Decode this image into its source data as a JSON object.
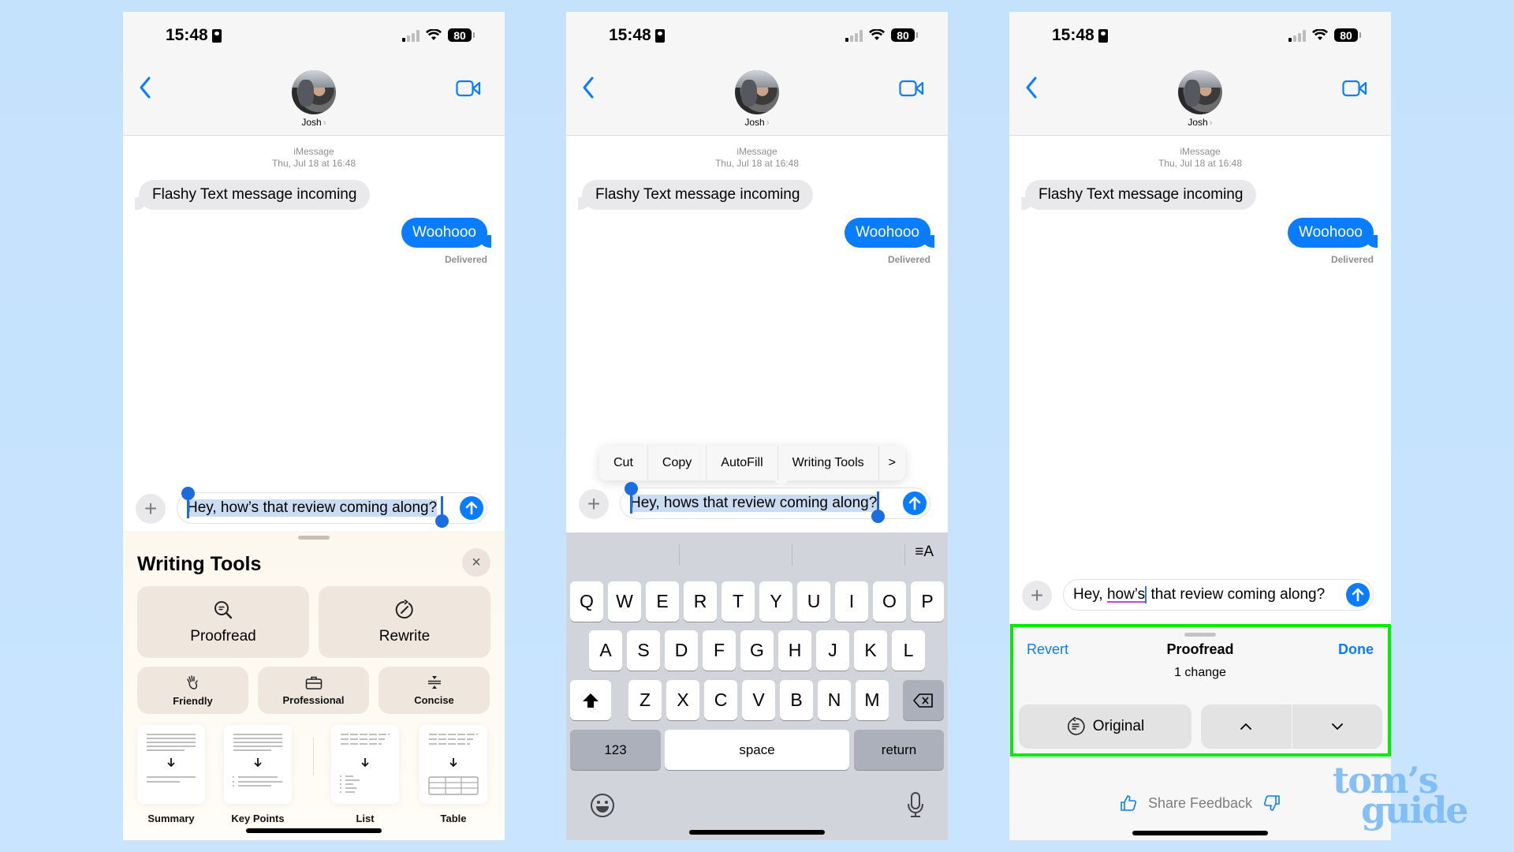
{
  "colors": {
    "background": "#c6e3fd",
    "accent": "#0a7cff",
    "highlight_frame": "#00ee00",
    "selection": "#c9dcf2"
  },
  "common": {
    "status": {
      "time": "15:48",
      "battery": "80",
      "icons": [
        "focus-icon",
        "signal-icon",
        "wifi-icon",
        "battery-icon"
      ]
    },
    "contact": {
      "name": "Josh",
      "chevron": "›"
    },
    "thread": {
      "service": "iMessage",
      "date": "Thu, Jul 18 at 16:48",
      "incoming": "Flashy Text message incoming",
      "outgoing": "Woohooo",
      "delivered": "Delivered"
    }
  },
  "phone1": {
    "input_text": "Hey, how’s that review coming along?",
    "writing_tools": {
      "title": "Writing Tools",
      "close_icon": "×",
      "primary": [
        {
          "label": "Proofread",
          "icon": "proofread-icon"
        },
        {
          "label": "Rewrite",
          "icon": "rewrite-icon"
        }
      ],
      "tones": [
        {
          "label": "Friendly",
          "icon": "wave-hand-icon"
        },
        {
          "label": "Professional",
          "icon": "briefcase-icon"
        },
        {
          "label": "Concise",
          "icon": "compress-icon"
        }
      ],
      "formats": [
        {
          "label": "Summary"
        },
        {
          "label": "Key Points"
        },
        {
          "label": "List"
        },
        {
          "label": "Table"
        }
      ]
    }
  },
  "phone2": {
    "input_text": "Hey, hows that review coming along?",
    "edit_menu": [
      "Cut",
      "Copy",
      "AutoFill",
      "Writing Tools",
      ">"
    ],
    "keyboard": {
      "row1": [
        "Q",
        "W",
        "E",
        "R",
        "T",
        "Y",
        "U",
        "I",
        "O",
        "P"
      ],
      "row2": [
        "A",
        "S",
        "D",
        "F",
        "G",
        "H",
        "J",
        "K",
        "L"
      ],
      "row3": [
        "Z",
        "X",
        "C",
        "V",
        "B",
        "N",
        "M"
      ],
      "numbers": "123",
      "space": "space",
      "return": "return",
      "format_icon": "≡A"
    }
  },
  "phone3": {
    "input_before": "Hey, ",
    "input_correction": "how’s",
    "input_after": " that review coming along?",
    "proofread": {
      "revert": "Revert",
      "title": "Proofread",
      "done": "Done",
      "changes": "1 change",
      "original": "Original"
    },
    "feedback": "Share Feedback"
  },
  "watermark": {
    "line1": "tom’s",
    "line2": "guide"
  }
}
